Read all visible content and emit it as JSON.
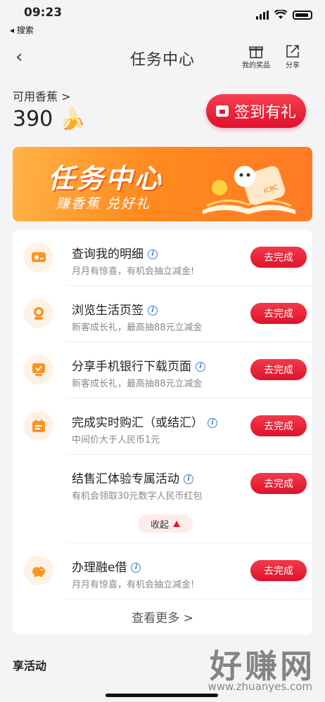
{
  "status_bar": {
    "time": "09:23",
    "back_app": "◂ 搜索"
  },
  "nav": {
    "back": "‹",
    "title": "任务中心",
    "prize_label": "我的奖品",
    "share_label": "分享"
  },
  "balance": {
    "label": "可用香蕉 >",
    "value": "390 🍌"
  },
  "signin": {
    "label": "签到有礼"
  },
  "banner": {
    "title": "任务中心",
    "subtitle": "赚香蕉 兑好礼",
    "badge": "ICBC"
  },
  "tasks": [
    {
      "title": "查询我的明细",
      "desc": "月月有惊喜，有机会抽立减金!",
      "button": "去完成",
      "icon": "card-icon"
    },
    {
      "title": "浏览生活页签",
      "desc": "新客成长礼，最高抽88元立减金",
      "button": "去完成",
      "icon": "life-icon"
    },
    {
      "title": "分享手机银行下载页面",
      "desc": "新客成长礼，最高抽88元立减金",
      "button": "去完成",
      "icon": "phone-check-icon"
    },
    {
      "title": "完成实时购汇（或结汇）",
      "desc": "中间价大于人民币1元",
      "button": "去完成",
      "icon": "calendar-icon"
    },
    {
      "title": "结售汇体验专属活动",
      "desc": "有机会领取30元数字人民币红包",
      "button": "去完成",
      "icon": ""
    },
    {
      "title": "办理融e借",
      "desc": "月月有惊喜，有机会抽立减金!",
      "button": "去完成",
      "icon": "piggy-bank-icon"
    }
  ],
  "collapse": {
    "label": "收起"
  },
  "view_more": {
    "label": "查看更多 >"
  },
  "section": {
    "title": "享活动"
  },
  "watermark": {
    "text": "好赚网",
    "url": "www.zhuanyes.com"
  },
  "colors": {
    "accent_red": "#e8172e",
    "icon_orange": "#ff9320",
    "banner_orange": "#ff8a1e"
  }
}
